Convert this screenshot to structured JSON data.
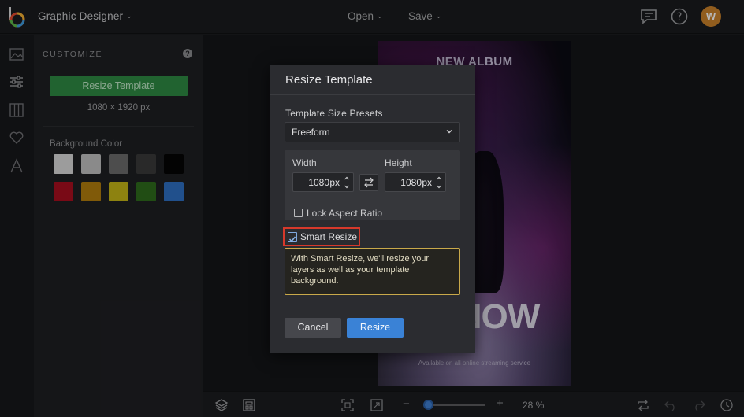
{
  "app": {
    "name": "Graphic Designer"
  },
  "topbar": {
    "open_label": "Open",
    "save_label": "Save",
    "avatar_initial": "W"
  },
  "panel": {
    "title": "CUSTOMIZE",
    "resize_button": "Resize Template",
    "template_size": "1080 × 1920 px",
    "background_label": "Background Color",
    "swatches": [
      "#d9d9d9",
      "#bfbfbf",
      "#6b6b6b",
      "#3a3a3a",
      "#050505",
      "#a80f1f",
      "#b27d0d",
      "#c4b417",
      "#2f6b1d",
      "#2e6fc2"
    ]
  },
  "poster": {
    "title": "NEW ALBUM",
    "big_text": "NOW",
    "subtitle": "Available on all online streaming service"
  },
  "bottombar": {
    "zoom": "28 %",
    "zoom_level": 0.28
  },
  "modal": {
    "title": "Resize Template",
    "presets_label": "Template Size Presets",
    "preset_value": "Freeform",
    "width_label": "Width",
    "height_label": "Height",
    "width_value": "1080",
    "height_value": "1080",
    "unit": "px",
    "lock_label": "Lock Aspect Ratio",
    "lock_checked": false,
    "smart_label": "Smart Resize",
    "smart_checked": true,
    "smart_note": "With Smart Resize, we'll resize your layers as well as your template background.",
    "cancel_label": "Cancel",
    "resize_label": "Resize"
  }
}
